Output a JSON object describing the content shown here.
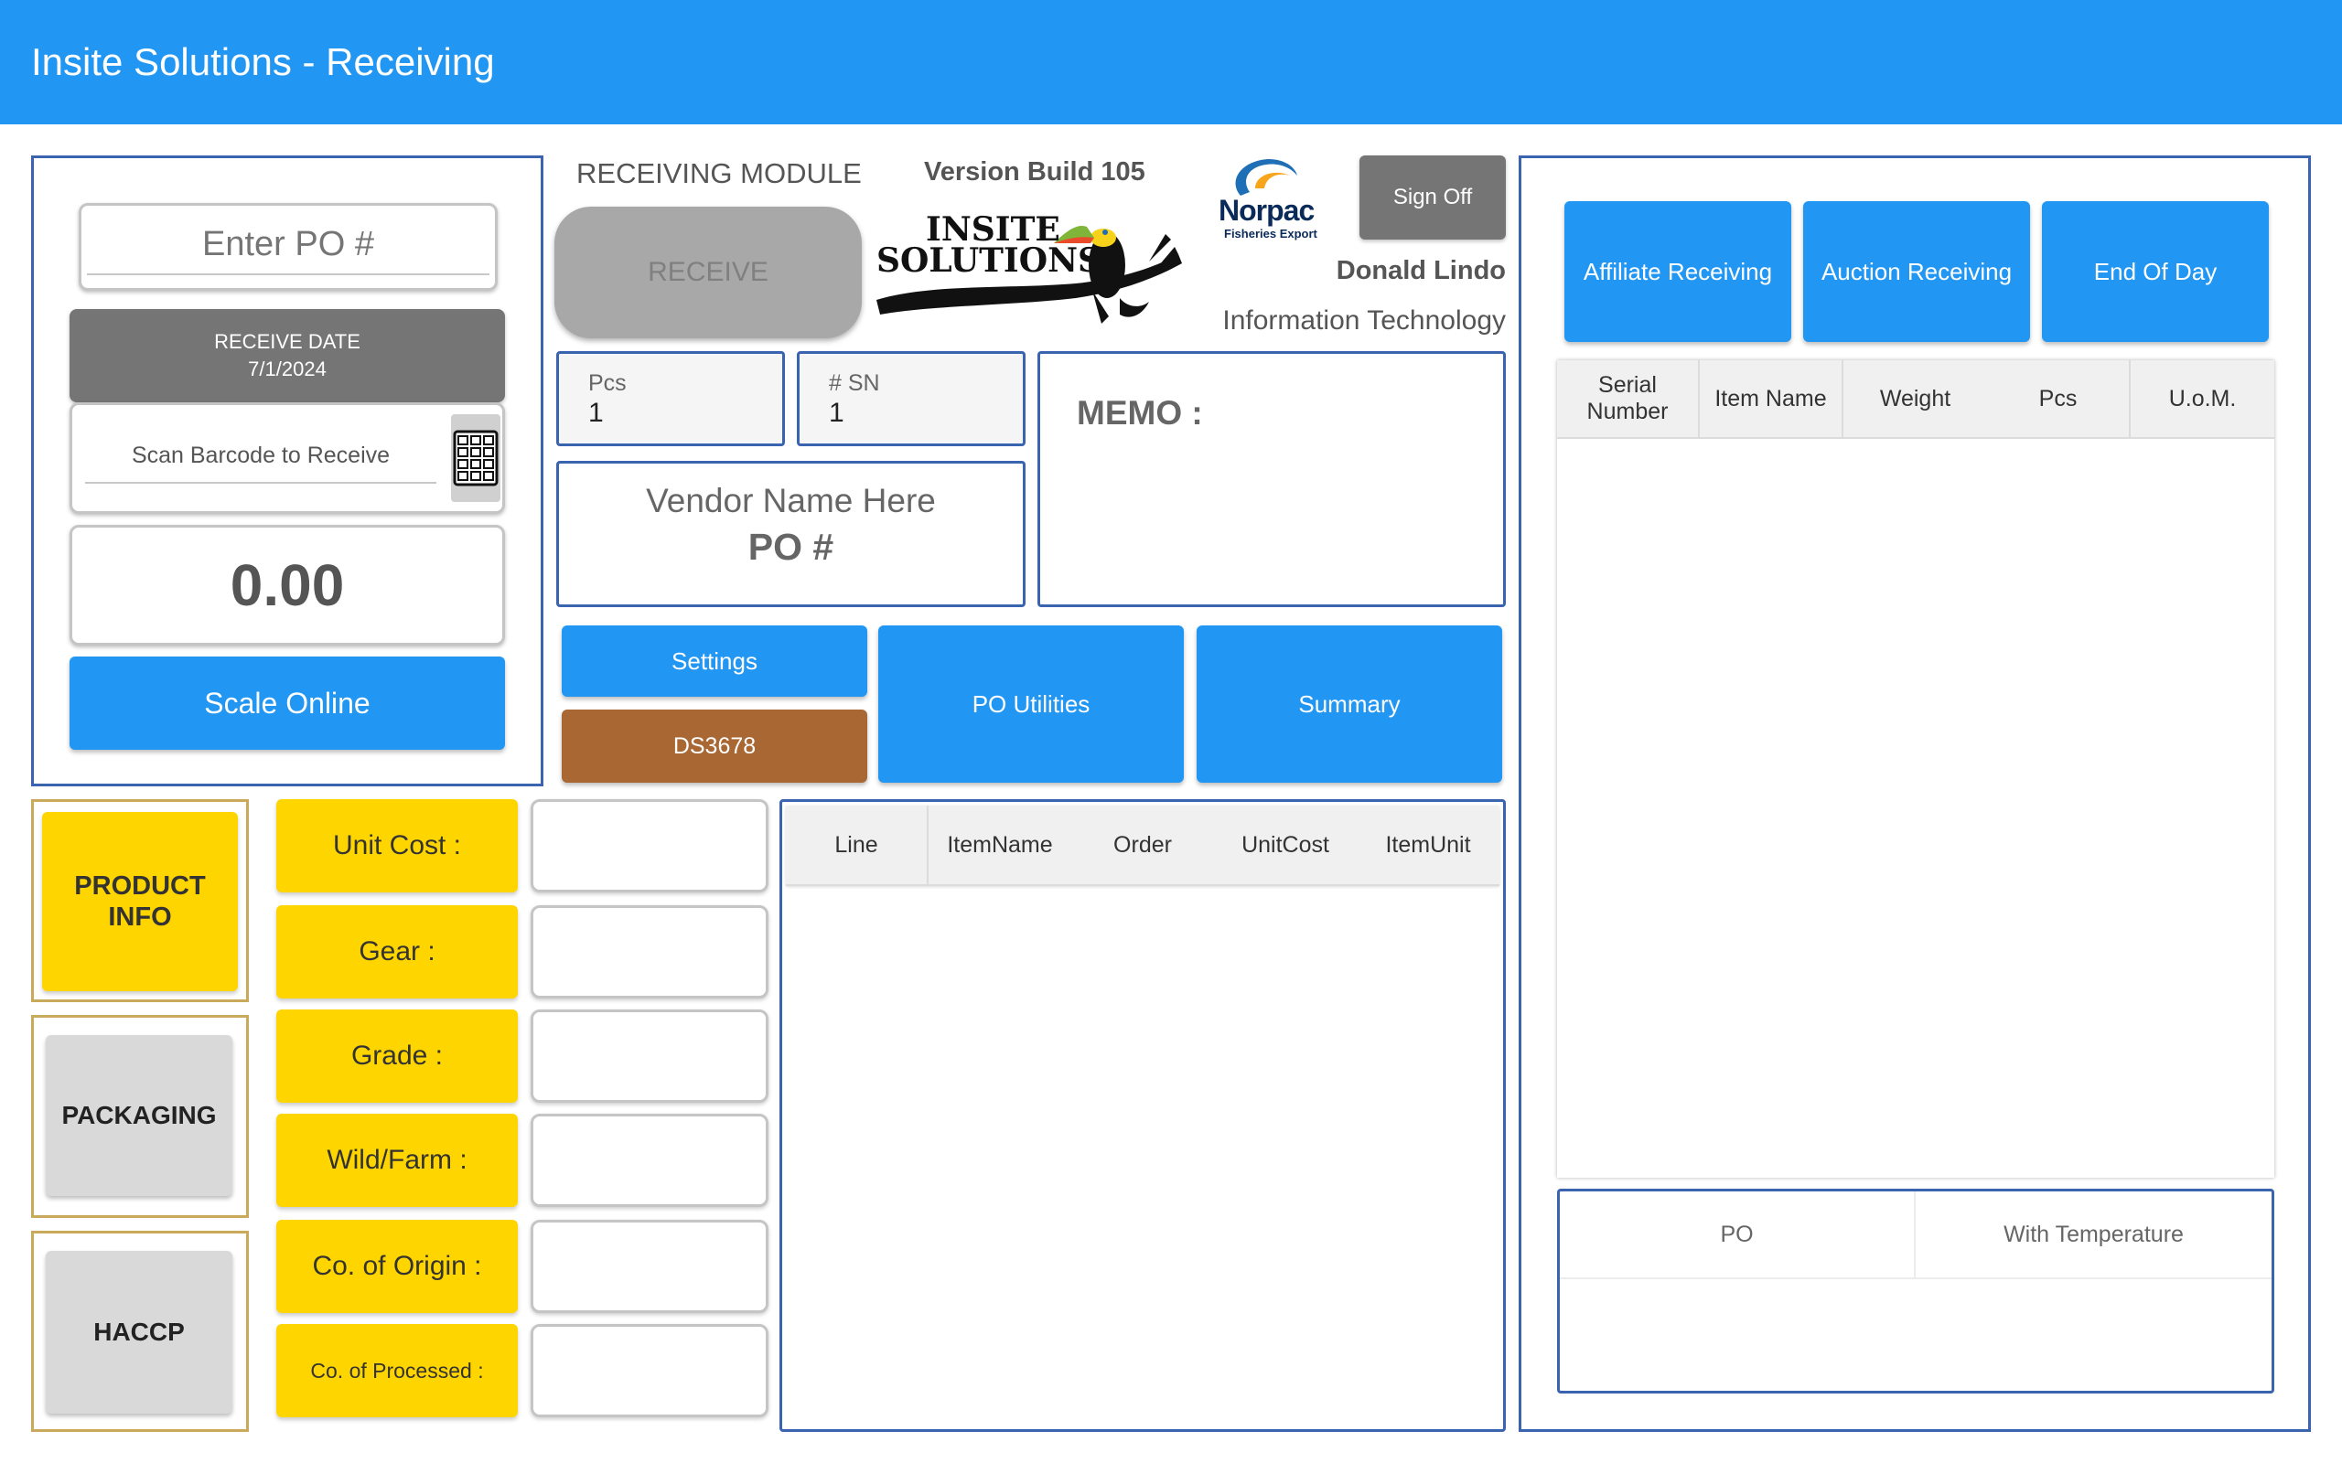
{
  "app_bar": {
    "title": "Insite Solutions - Receiving"
  },
  "left_panel": {
    "po_input_placeholder": "Enter PO #",
    "receive_date_label": "RECEIVE DATE",
    "receive_date_value": "7/1/2024",
    "scan_placeholder": "Scan Barcode to Receive",
    "weight_value": "0.00",
    "scale_button": "Scale Online"
  },
  "header": {
    "module_title": "RECEIVING MODULE",
    "version": "Version Build 105",
    "receive_button": "RECEIVE",
    "logo_text_line1": "INSITE",
    "logo_text_line2": "SOLUTIONS",
    "norpac_logo_name": "Norpac",
    "norpac_logo_sub": "Fisheries Export",
    "sign_off_button": "Sign Off",
    "user_name": "Donald Lindo",
    "user_department": "Information Technology"
  },
  "fields": {
    "pcs_label": "Pcs",
    "pcs_value": "1",
    "sn_label": "# SN",
    "sn_value": "1",
    "vendor_name": "Vendor Name Here",
    "po_label": "PO #",
    "memo_label": "MEMO :"
  },
  "actions": {
    "settings": "Settings",
    "device": "DS3678",
    "po_utilities": "PO Utilities",
    "summary": "Summary"
  },
  "right_buttons": {
    "affiliate": "Affiliate Receiving",
    "auction": "Auction Receiving",
    "end_of_day": "End Of Day"
  },
  "serial_table": {
    "headers": [
      "Serial Number",
      "Item Name",
      "Weight",
      "Pcs",
      "U.o.M."
    ]
  },
  "po_temp_table": {
    "headers": [
      "PO",
      "With Temperature"
    ]
  },
  "side_tabs": {
    "product_info": "PRODUCT INFO",
    "packaging": "PACKAGING",
    "haccp": "HACCP"
  },
  "product_fields": [
    {
      "label": "Unit Cost :",
      "value": ""
    },
    {
      "label": "Gear :",
      "value": ""
    },
    {
      "label": "Grade :",
      "value": ""
    },
    {
      "label": "Wild/Farm :",
      "value": ""
    },
    {
      "label": "Co. of Origin :",
      "value": ""
    },
    {
      "label": "Co. of Processed :",
      "value": ""
    }
  ],
  "line_table": {
    "headers": [
      "Line",
      "ItemName",
      "Order",
      "UnitCost",
      "ItemUnit"
    ]
  },
  "colors": {
    "app_bar": "#2196f3",
    "panel_border": "#3a64b0",
    "yellow": "#ffd500",
    "device_brown": "#a86733"
  }
}
